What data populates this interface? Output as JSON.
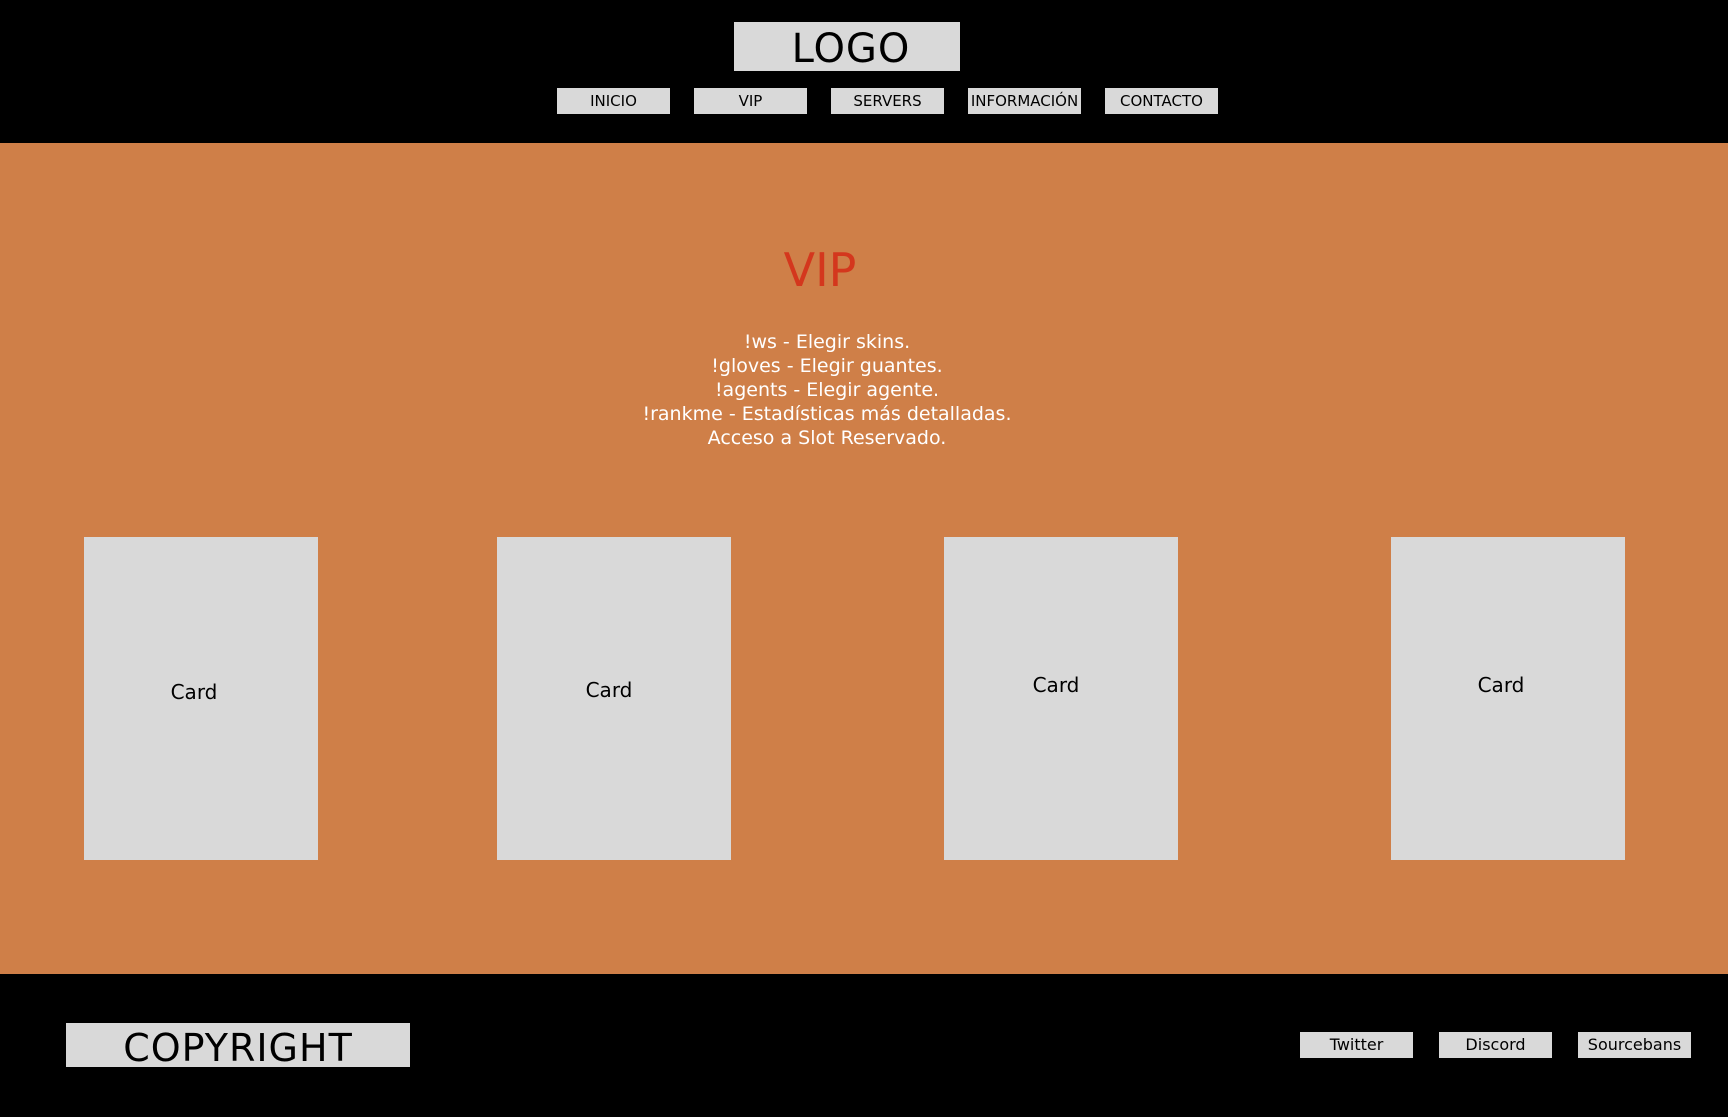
{
  "header": {
    "logo": "LOGO",
    "nav": [
      {
        "label": "INICIO"
      },
      {
        "label": "VIP"
      },
      {
        "label": "SERVERS"
      },
      {
        "label": "INFORMACIÓN"
      },
      {
        "label": "CONTACTO"
      }
    ]
  },
  "main": {
    "title": "VIP",
    "features": [
      "!ws - Elegir skins.",
      "!gloves - Elegir guantes.",
      "!agents - Elegir agente.",
      "!rankme - Estadísticas más detalladas.",
      "Acceso a Slot Reservado."
    ],
    "cards": [
      {
        "label": "Card"
      },
      {
        "label": "Card"
      },
      {
        "label": "Card"
      },
      {
        "label": "Card"
      }
    ]
  },
  "footer": {
    "copyright": "COPYRIGHT",
    "links": [
      {
        "label": "Twitter"
      },
      {
        "label": "Discord"
      },
      {
        "label": "Sourcebans"
      }
    ]
  },
  "colors": {
    "background": "#000000",
    "main_background": "#cf7f48",
    "button_fill": "#d9d9d9",
    "title_accent": "#d4371d",
    "feature_text": "#ffffff"
  }
}
